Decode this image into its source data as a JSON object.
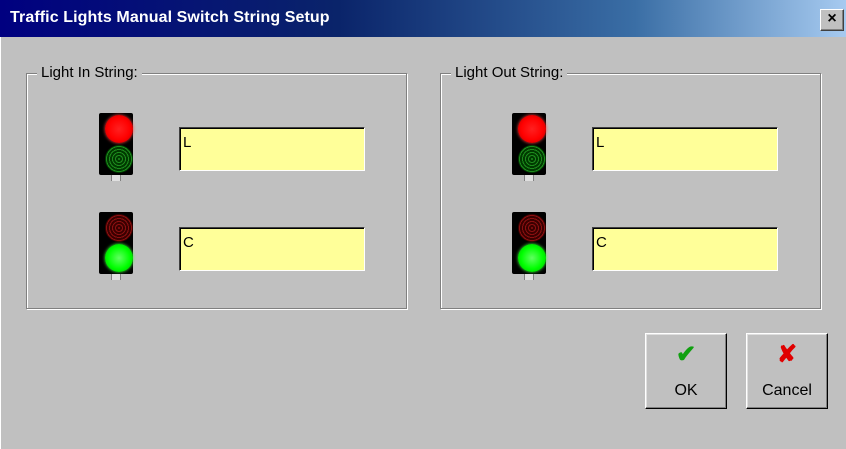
{
  "window": {
    "title": "Traffic Lights Manual Switch String Setup",
    "close_glyph": "×"
  },
  "light_in": {
    "label": "Light In String:",
    "red_value": "L",
    "green_value": "C"
  },
  "light_out": {
    "label": "Light Out String:",
    "red_value": "L",
    "green_value": "C"
  },
  "buttons": {
    "ok_label": "OK",
    "ok_icon": "✔",
    "cancel_label": "Cancel",
    "cancel_icon": "✘"
  },
  "colors": {
    "field_background": "#ffff99",
    "red_light_on": "#ff0000",
    "green_light_on": "#00ff00"
  }
}
